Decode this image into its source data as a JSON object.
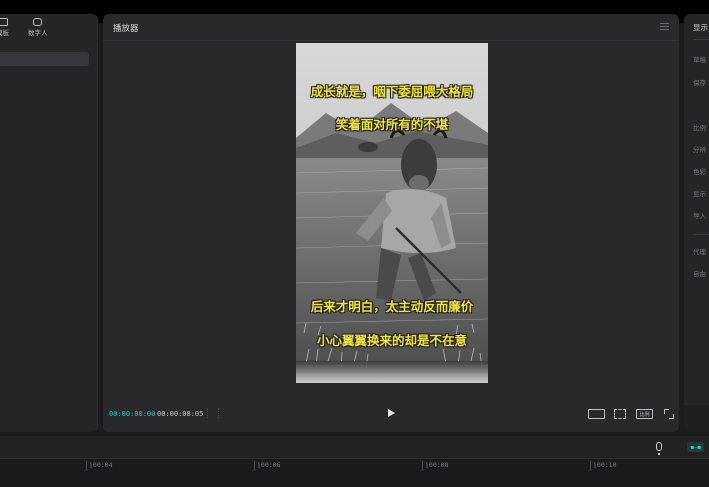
{
  "left_panel": {
    "tabs": [
      {
        "label": "模板",
        "icon": "template-icon"
      },
      {
        "label": "数字人",
        "icon": "digital-human-icon"
      }
    ]
  },
  "player": {
    "title": "播放器",
    "captions": [
      "成长就是，咽下委屈喂大格局",
      "笑着面对所有的不堪",
      "后来才明白，太主动反而廉价",
      "小心翼翼换来的却是不在意"
    ],
    "time_current": "00:00:00:00",
    "time_total": "00:00:08:05",
    "controls": {
      "play": "play-icon",
      "subtitle": "subtitle-icon",
      "focus": "focus-icon",
      "ratio_label": "比例",
      "fullscreen": "fullscreen-icon"
    },
    "accent_color": "#1fcfd0",
    "caption_color": "#f2e63a"
  },
  "right_panel": {
    "title": "显示",
    "items": [
      "草稿",
      "保存",
      "比例",
      "分辨",
      "色彩",
      "显示",
      "导入",
      "代理",
      "自由"
    ]
  },
  "timeline": {
    "ticks": [
      "|00:04",
      "|00:06",
      "|00:08",
      "|00:10"
    ]
  }
}
